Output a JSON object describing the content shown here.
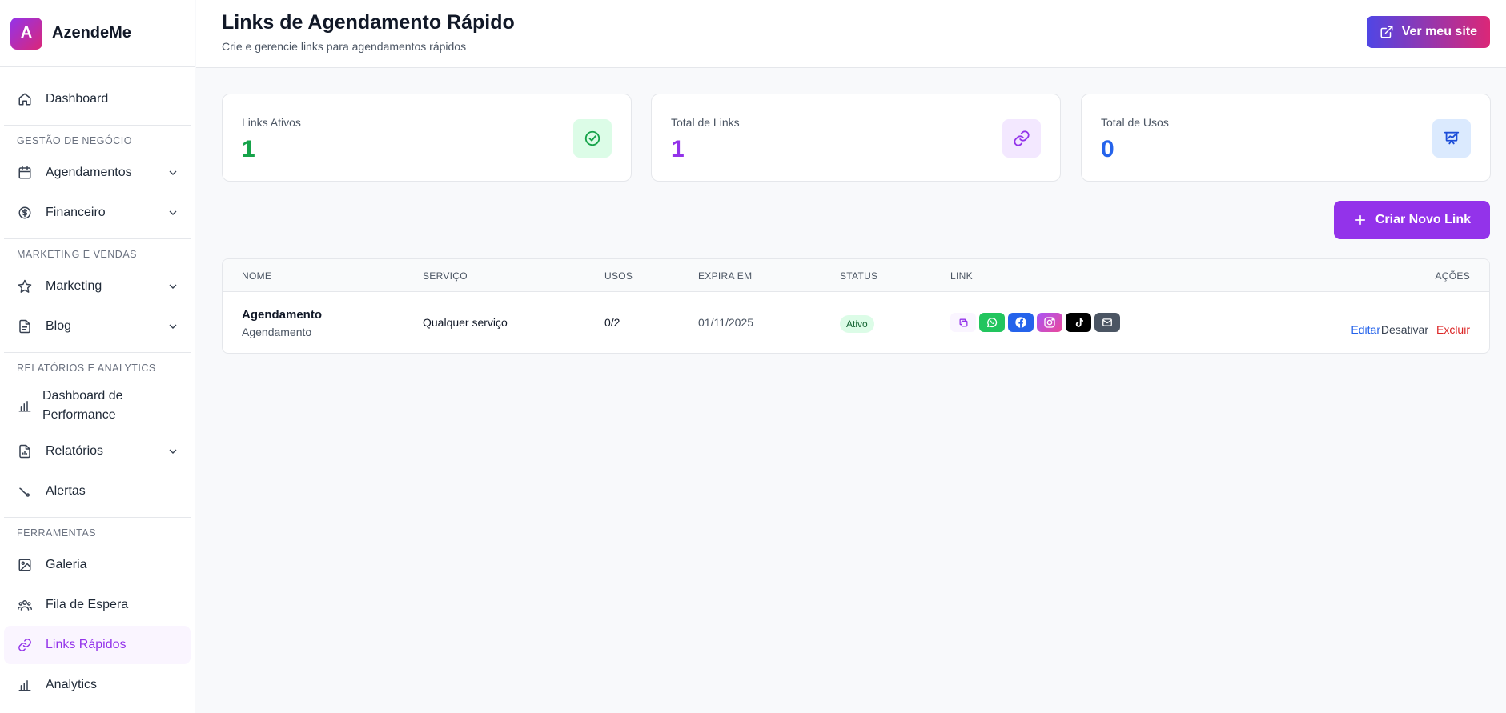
{
  "brand": {
    "logo_letter": "A",
    "name": "AzendeMe",
    "gradient": [
      "#9333ea",
      "#db2777"
    ]
  },
  "sidebar": {
    "dashboard": "Dashboard",
    "sections": {
      "gestao": "GESTÃO DE NEGÓCIO",
      "marketing": "MARKETING E VENDAS",
      "relatorios": "RELATÓRIOS E ANALYTICS",
      "ferramentas": "FERRAMENTAS"
    },
    "items": {
      "agendamentos": "Agendamentos",
      "financeiro": "Financeiro",
      "marketing": "Marketing",
      "blog": "Blog",
      "dashboard_perf": "Dashboard de Performance",
      "relatorios": "Relatórios",
      "alertas": "Alertas",
      "galeria": "Galeria",
      "fila": "Fila de Espera",
      "links": "Links Rápidos",
      "analytics": "Analytics"
    },
    "active": "links"
  },
  "header": {
    "title": "Links de Agendamento Rápido",
    "subtitle": "Crie e gerencie links para agendamentos rápidos",
    "site_button": "Ver meu site"
  },
  "stats": [
    {
      "label": "Links Ativos",
      "value": "1",
      "color": "#16a34a",
      "icon": "check-circle-icon",
      "icon_bg": "#dcfce7"
    },
    {
      "label": "Total de Links",
      "value": "1",
      "color": "#9333ea",
      "icon": "link-icon",
      "icon_bg": "#f3e8ff"
    },
    {
      "label": "Total de Usos",
      "value": "0",
      "color": "#2563eb",
      "icon": "presentation-chart-icon",
      "icon_bg": "#dbeafe"
    }
  ],
  "create_button": "Criar Novo Link",
  "table": {
    "headers": [
      "NOME",
      "SERVIÇO",
      "USOS",
      "EXPIRA EM",
      "STATUS",
      "LINK",
      "AÇÕES"
    ],
    "rows": [
      {
        "name": "Agendamento",
        "subname": "Agendamento",
        "service": "Qualquer serviço",
        "uses": "0/2",
        "expires": "01/11/2025",
        "status": "Ativo",
        "share_icons": [
          "copy-icon",
          "whatsapp-icon",
          "facebook-icon",
          "instagram-icon",
          "tiktok-icon",
          "email-icon"
        ],
        "actions": {
          "edit": "Editar",
          "deactivate": "Desativar",
          "delete": "Excluir"
        }
      }
    ]
  },
  "colors": {
    "accent": "#9333ea",
    "whatsapp": "#22c55e",
    "facebook": "#2563eb",
    "instagram": "#ec4899",
    "tiktok": "#000000",
    "email": "#4b5563",
    "edit": "#2563eb",
    "delete": "#dc2626"
  }
}
